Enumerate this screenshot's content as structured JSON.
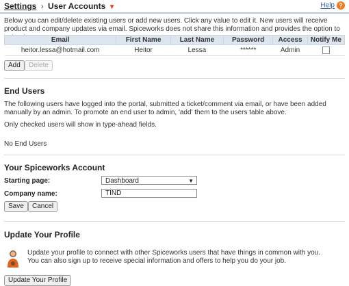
{
  "header": {
    "crumb_root": "Settings",
    "crumb_sep": "›",
    "crumb_current": "User Accounts",
    "help_label": "Help",
    "help_icon": "?"
  },
  "intro": "Below you can edit/delete existing users or add new users. Click any value to edit it. New users will receive product and company updates via email. Spiceworks does not share this information and provides the option to opt-out.",
  "users_table": {
    "columns": [
      "Email",
      "First Name",
      "Last Name",
      "Password",
      "Access",
      "Notify Me"
    ],
    "rows": [
      {
        "email": "heitor.lessa@hotmail.com",
        "first": "Heitor",
        "last": "Lessa",
        "password": "******",
        "access": "Admin",
        "notify": false
      }
    ]
  },
  "actions": {
    "add": "Add",
    "delete": "Delete"
  },
  "end_users": {
    "title": "End Users",
    "desc": "The following users have logged into the portal, submitted a ticket/comment via email, or have been added manually by an admin. To promote an end user to admin, 'add' them to the users table above.",
    "note": "Only checked users will show in type-ahead fields.",
    "empty": "No End Users"
  },
  "account": {
    "title": "Your Spiceworks Account",
    "starting_page_label": "Starting page:",
    "starting_page_value": "Dashboard",
    "company_label": "Company name:",
    "company_value": "TIND",
    "save": "Save",
    "cancel": "Cancel"
  },
  "profile": {
    "title": "Update Your Profile",
    "line1": "Update your profile to connect with other Spiceworks users that have things in common with you.",
    "line2": "You can also sign up to receive special information and offers to help you do your job.",
    "button": "Update Your Profile"
  },
  "colors": {
    "accent": "#f07a22",
    "link": "#2a5db0",
    "table_header": "#dde6ef"
  }
}
